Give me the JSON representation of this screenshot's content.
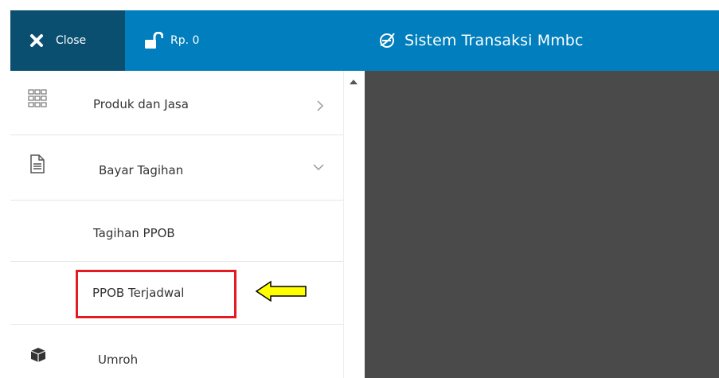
{
  "topbar": {
    "close_label": "Close",
    "balance_label": "Rp. 0",
    "title": "Sistem Transaksi Mmbc",
    "colors": {
      "bar": "#007ebd",
      "close_bg": "#0b4f70",
      "text": "#ffffff"
    },
    "icons": {
      "close": "close-icon",
      "lock": "unlock-icon",
      "title": "browser-icon"
    }
  },
  "sidebar": {
    "items": [
      {
        "label": "Produk dan Jasa",
        "icon": "grid-icon",
        "chevron": "chevron-right-icon"
      },
      {
        "label": "Bayar Tagihan",
        "icon": "document-icon",
        "chevron": "chevron-down-icon"
      },
      {
        "label": "Tagihan PPOB"
      },
      {
        "label": "PPOB Terjadwal"
      },
      {
        "label": "Umroh",
        "icon": "box-icon"
      }
    ]
  },
  "annotation": {
    "highlight_color": "#e31b23",
    "arrow_color": "#ffff00"
  },
  "content": {
    "background": "#4a4a4a"
  }
}
